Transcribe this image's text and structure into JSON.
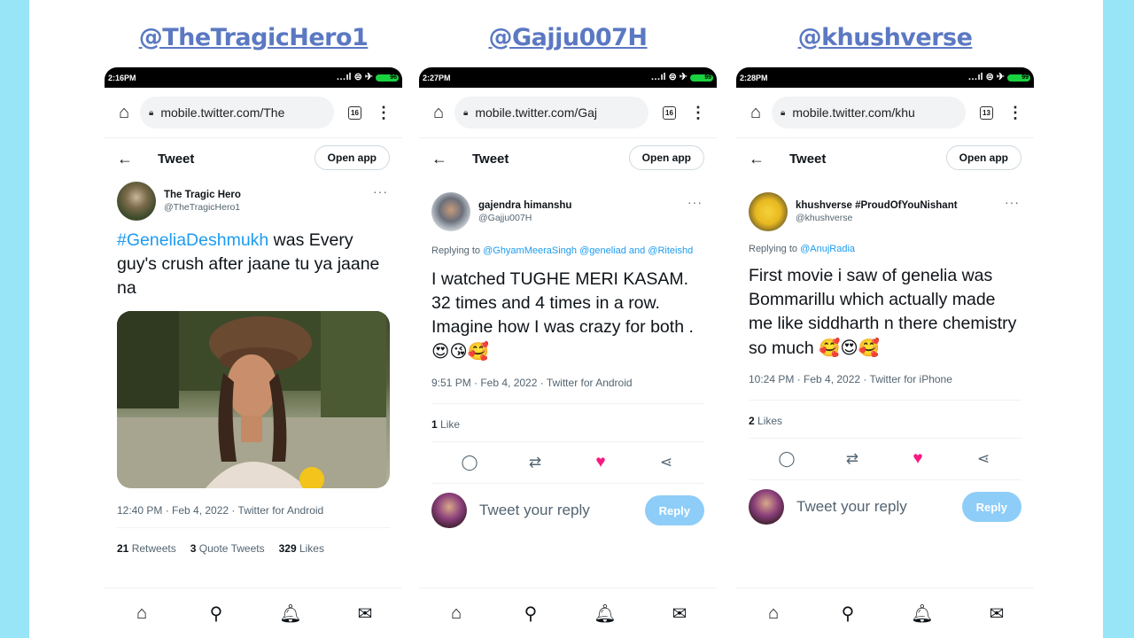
{
  "panels": [
    {
      "handle": "@TheTragicHero1",
      "time": "2:16PM",
      "battery": "96",
      "tabs_count": "16",
      "url": "mobile.twitter.com/The",
      "header_title": "Tweet",
      "open_app": "Open app",
      "display_name": "The Tragic Hero",
      "username": "@TheTragicHero1",
      "reply_to_label": "",
      "reply_to_users": "",
      "text_hashtag": "#GeneliaDeshmukh",
      "text": " was Every guy's crush after jaane tu ya jaane na",
      "timestamp": "12:40 PM · Feb 4, 2022 · Twitter for Android",
      "retweets_count": "21",
      "retweets_label": "Retweets",
      "quotes_count": "3",
      "quotes_label": "Quote Tweets",
      "likes_count": "329",
      "likes_label": "Likes"
    },
    {
      "handle": "@Gajju007H",
      "time": "2:27PM",
      "battery": "99",
      "tabs_count": "16",
      "url": "mobile.twitter.com/Gaj",
      "header_title": "Tweet",
      "open_app": "Open app",
      "display_name": "gajendra himanshu",
      "username": "@Gajju007H",
      "reply_to_label": "Replying to ",
      "reply_to_users": "@GhyamMeeraSingh @geneliad and @Riteishd",
      "text": "I watched TUGHE MERI KASAM. 32 times and 4 times in a row. Imagine how I was crazy for both .",
      "emojis": "😍😘🥰",
      "timestamp": "9:51 PM · Feb 4, 2022 · Twitter for Android",
      "likes_count": "1",
      "likes_label": "Like",
      "reply_placeholder": "Tweet your reply",
      "reply_button": "Reply"
    },
    {
      "handle": "@khushverse",
      "time": "2:28PM",
      "battery": "99",
      "tabs_count": "13",
      "url": "mobile.twitter.com/khu",
      "header_title": "Tweet",
      "open_app": "Open app",
      "display_name": "khushverse #ProudOfYouNishant",
      "username": "@khushverse",
      "reply_to_label": "Replying to ",
      "reply_to_users": "@AnujRadia",
      "text": "First movie i saw of genelia was Bommarillu which actually made me like siddharth n there chemistry so much",
      "emojis": "🥰😍🥰",
      "timestamp": "10:24 PM · Feb 4, 2022 · Twitter for iPhone",
      "likes_count": "2",
      "likes_label": "Likes",
      "reply_placeholder": "Tweet your reply",
      "reply_button": "Reply"
    }
  ],
  "icons": {
    "home": "home-icon",
    "lock": "lock-icon",
    "tabs": "tabs-icon",
    "menu": "menu-icon",
    "back": "back-arrow-icon",
    "reply": "reply-icon",
    "retweet": "retweet-icon",
    "like": "heart-icon",
    "share": "share-icon",
    "nav": [
      "home-nav-icon",
      "search-icon",
      "notifications-icon",
      "messages-icon"
    ]
  },
  "colors": {
    "background_band": "#99e5f8",
    "handle_title": "#5b78c2",
    "link_blue": "#1d9bf0",
    "like_pink": "#f91880",
    "reply_button": "#8ecdf8"
  }
}
